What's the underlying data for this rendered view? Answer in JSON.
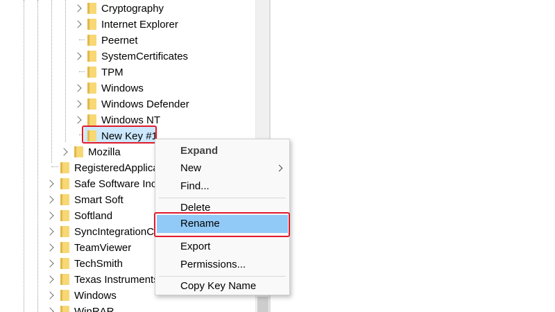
{
  "tree": {
    "items": [
      {
        "label": "Cryptography",
        "expandable": true
      },
      {
        "label": "Internet Explorer",
        "expandable": true
      },
      {
        "label": "Peernet",
        "expandable": false
      },
      {
        "label": "SystemCertificates",
        "expandable": true
      },
      {
        "label": "TPM",
        "expandable": false
      },
      {
        "label": "Windows",
        "expandable": true
      },
      {
        "label": "Windows Defender",
        "expandable": true
      },
      {
        "label": "Windows NT",
        "expandable": true
      },
      {
        "label": "New Key #1",
        "expandable": false,
        "selected": true
      },
      {
        "label": "Mozilla",
        "expandable": true
      },
      {
        "label": "RegisteredApplica",
        "expandable": false
      },
      {
        "label": "Safe Software Inc.",
        "expandable": true
      },
      {
        "label": "Smart Soft",
        "expandable": true
      },
      {
        "label": "Softland",
        "expandable": true
      },
      {
        "label": "SyncIntegrationCli",
        "expandable": true
      },
      {
        "label": "TeamViewer",
        "expandable": true
      },
      {
        "label": "TechSmith",
        "expandable": true
      },
      {
        "label": "Texas Instruments",
        "expandable": true
      },
      {
        "label": "Windows",
        "expandable": true
      },
      {
        "label": "WinRAR",
        "expandable": true
      }
    ]
  },
  "context_menu": {
    "expand": "Expand",
    "new": "New",
    "find": "Find...",
    "delete": "Delete",
    "rename": "Rename",
    "export": "Export",
    "permissions": "Permissions...",
    "copy_key_name": "Copy Key Name"
  },
  "colors": {
    "selection": "#cce8ff",
    "menu_hover": "#91c9f7",
    "annotation": "#e0192a",
    "folder": "#f8d775"
  },
  "icons": {
    "folder": "folder-icon",
    "expand": "chevron-right-icon",
    "submenu": "chevron-right-icon"
  }
}
